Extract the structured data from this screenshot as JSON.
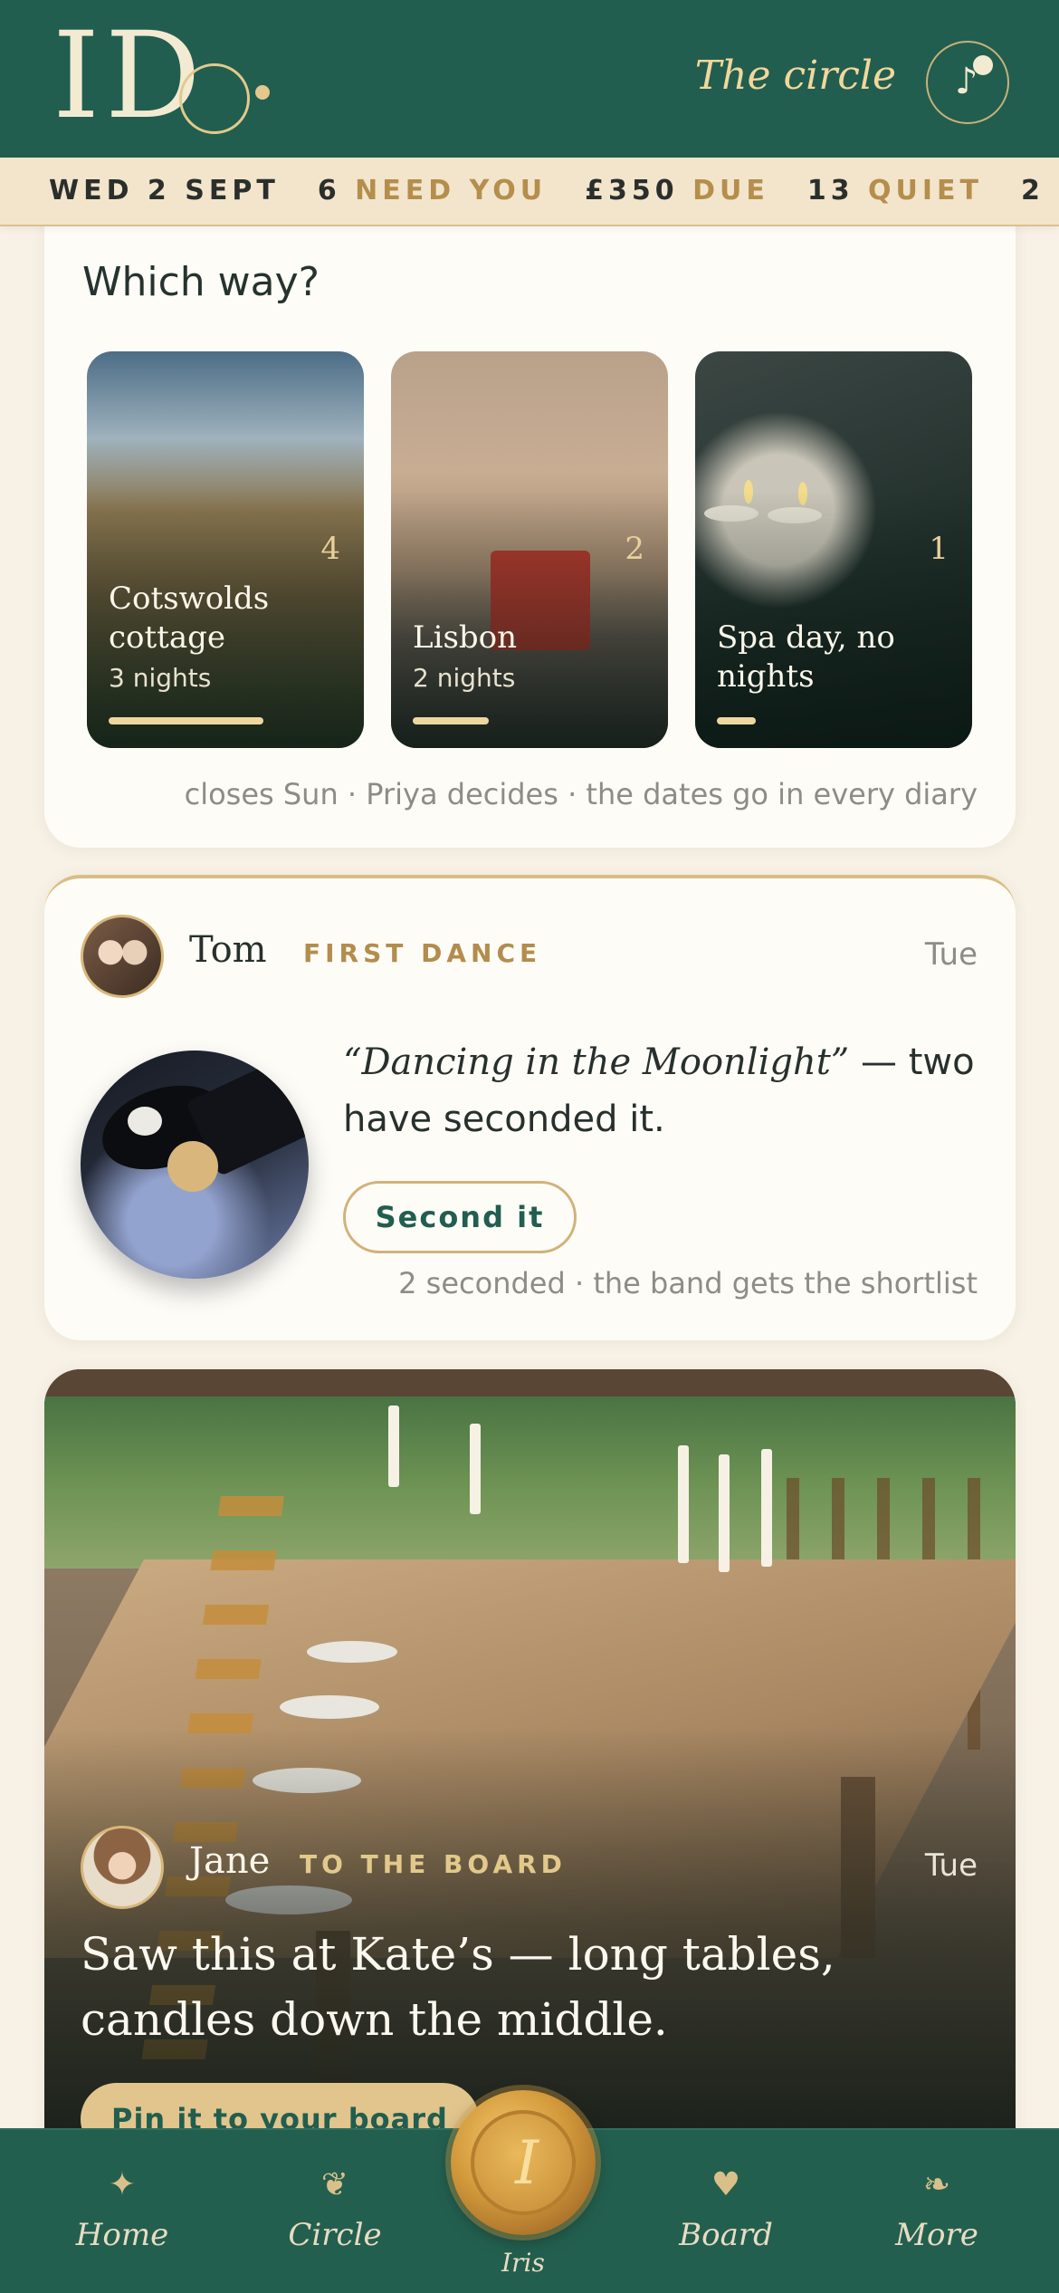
{
  "header": {
    "logo_text": "I Do",
    "title": "The circle",
    "music_icon": "music-note-icon"
  },
  "ticker": {
    "date": "WED 2 SEPT",
    "need_count": "6",
    "need_label": "NEED YOU",
    "due_amount": "£350",
    "due_label": "DUE",
    "quiet_count": "13",
    "quiet_label": "QUIET",
    "next_count": "2"
  },
  "vote": {
    "question": "Which way?",
    "options": [
      {
        "name": "Cotswolds cottage",
        "nights": "3 nights",
        "count": "4",
        "share": 0.67
      },
      {
        "name": "Lisbon",
        "nights": "2 nights",
        "count": "2",
        "share": 0.33
      },
      {
        "name": "Spa day, no nights",
        "nights": "",
        "count": "1",
        "share": 0.17
      }
    ],
    "footer": "closes Sun · Priya decides · the dates go in every diary"
  },
  "first_dance": {
    "author": "Tom",
    "tag": "FIRST DANCE",
    "day": "Tue",
    "song": "“Dancing in the Moonlight”",
    "message": " — two have seconded it.",
    "button": "Second it",
    "footer": "2 seconded · the band gets the shortlist"
  },
  "board_post": {
    "author": "Jane",
    "tag": "TO THE BOARD",
    "day": "Tue",
    "text": "Saw this at Kate’s — long tables, candles down the middle.",
    "button": "Pin it to your board"
  },
  "nav": {
    "home": {
      "label": "Home",
      "icon": "sparkle-icon"
    },
    "circle": {
      "label": "Circle",
      "icon": "circle-flower-icon"
    },
    "seal": {
      "label": "Iris",
      "letter": "I"
    },
    "board": {
      "label": "Board",
      "icon": "heart-icon"
    },
    "more": {
      "label": "More",
      "icon": "bird-icon"
    }
  },
  "colors": {
    "brand_green": "#215e4f",
    "gold": "#b58e4c",
    "cream": "#fdfcf7",
    "background": "#f7f1e6"
  }
}
